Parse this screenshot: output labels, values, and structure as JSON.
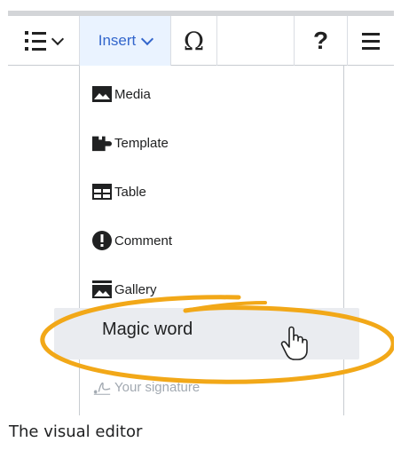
{
  "toolbar": {
    "insert_label": "Insert",
    "special_char": "Ω",
    "help": "?"
  },
  "insert_menu": {
    "items": [
      {
        "label": "Media",
        "icon": "media-icon"
      },
      {
        "label": "Template",
        "icon": "puzzle-icon"
      },
      {
        "label": "Table",
        "icon": "table-icon"
      },
      {
        "label": "Comment",
        "icon": "alert-icon"
      },
      {
        "label": "Gallery",
        "icon": "gallery-icon"
      },
      {
        "label": "Magic word",
        "icon": ""
      },
      {
        "label": "Your signature",
        "icon": "signature-icon"
      }
    ],
    "highlighted_index": 5
  },
  "annotation_color": "#f2a818",
  "caption": "The visual editor"
}
